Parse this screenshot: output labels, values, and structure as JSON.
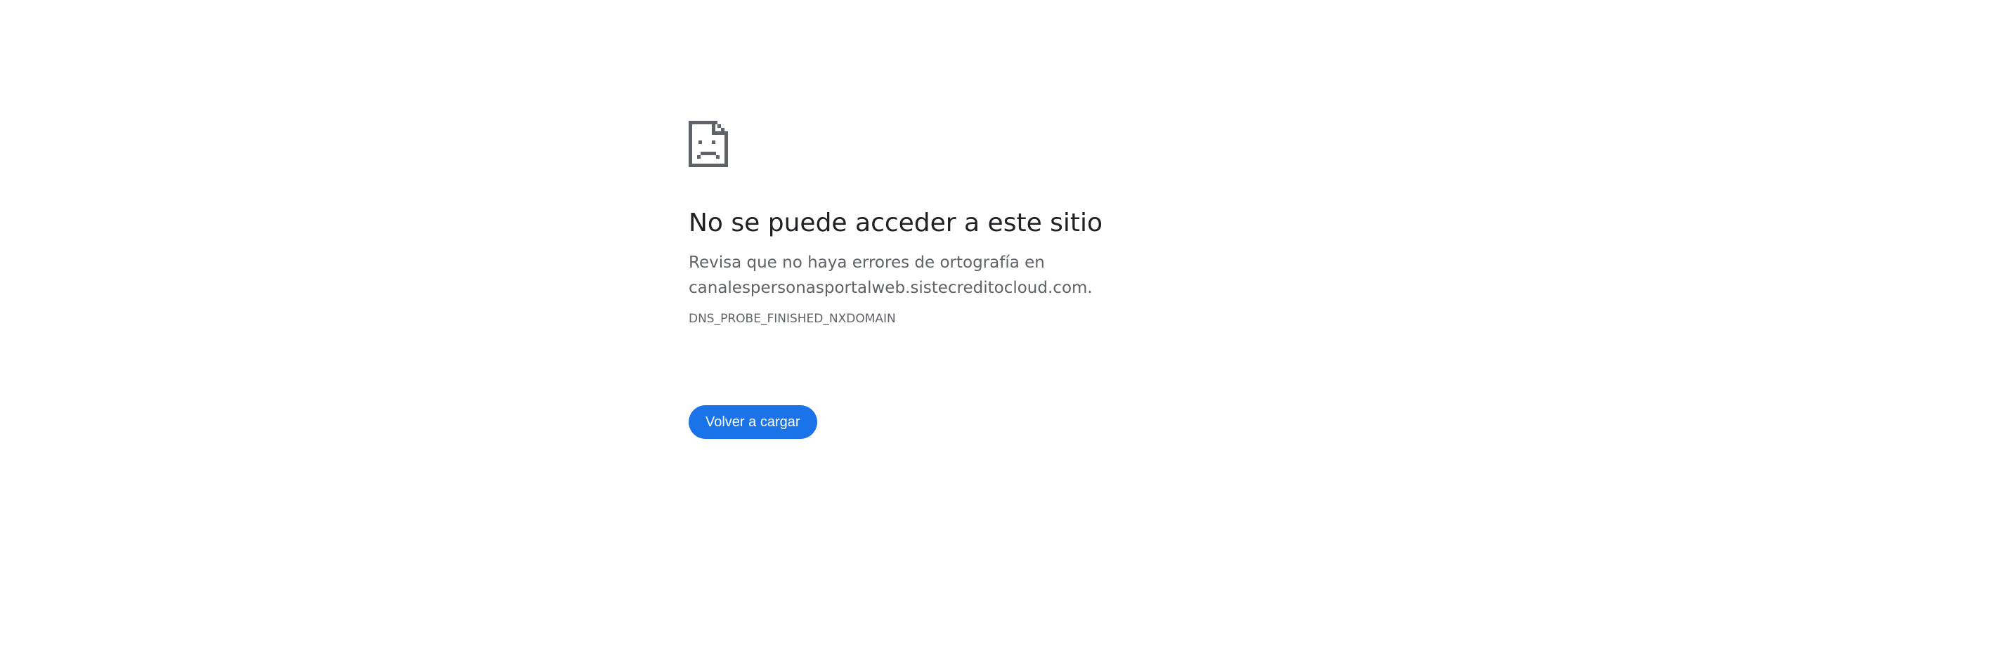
{
  "error": {
    "icon": "sad-page-icon",
    "title": "No se puede acceder a este sitio",
    "description_line1": "Revisa que no haya errores de ortografía en",
    "description_line2": "canalespersonasportalweb.sistecreditocloud.com.",
    "code": "DNS_PROBE_FINISHED_NXDOMAIN",
    "reload_label": "Volver a cargar"
  },
  "colors": {
    "title": "#202124",
    "text": "#5f6368",
    "button": "#1a73e8",
    "icon": "#5f6368"
  }
}
